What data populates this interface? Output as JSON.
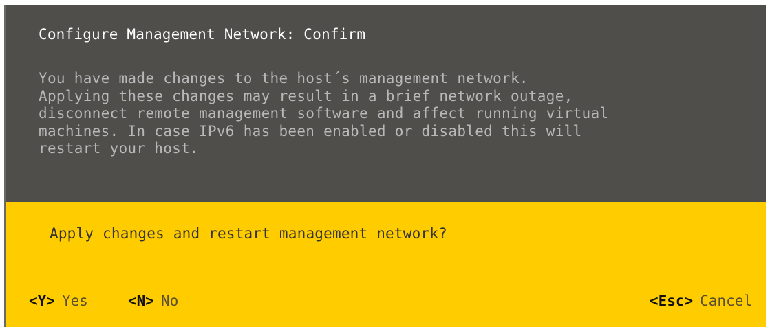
{
  "dialog": {
    "title": "Configure Management Network: Confirm",
    "message_lines": [
      "You have made changes to the host´s management network.",
      "Applying these changes may result in a brief network outage,",
      "disconnect remote management software and affect running virtual",
      "machines. In case IPv6 has been enabled or disabled this will",
      "restart your host."
    ],
    "question": "Apply changes and restart management network?"
  },
  "actions": {
    "yes": {
      "key": "<Y>",
      "label": "Yes"
    },
    "no": {
      "key": "<N>",
      "label": "No"
    },
    "cancel": {
      "key": "<Esc>",
      "label": "Cancel"
    }
  },
  "colors": {
    "header_bg": "#4f4e4b",
    "prompt_bg": "#ffcc00",
    "title_text": "#ffffff",
    "message_text": "#b8b8b8"
  }
}
